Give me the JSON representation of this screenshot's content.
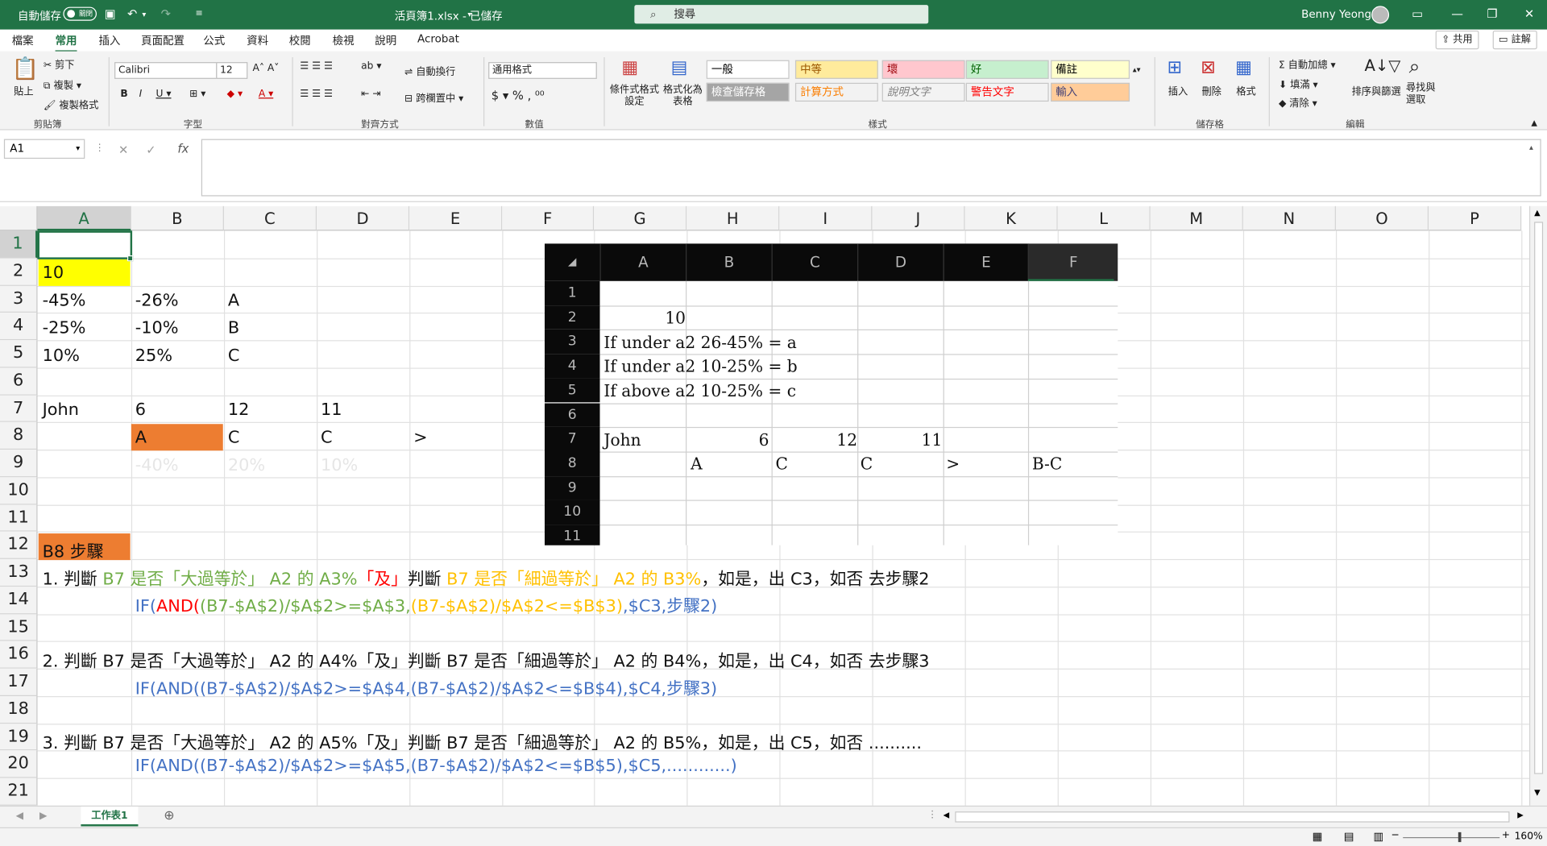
{
  "titlebar": {
    "autosave_label": "自動儲存",
    "autosave_state": "關閉",
    "doc_title": "活頁簿1.xlsx - 已儲存",
    "search_placeholder": "搜尋",
    "user_name": "Benny Yeong"
  },
  "tabs": [
    "檔案",
    "常用",
    "插入",
    "頁面配置",
    "公式",
    "資料",
    "校閱",
    "檢視",
    "說明",
    "Acrobat"
  ],
  "tab_buttons": {
    "share": "共用",
    "comments": "註解"
  },
  "ribbon": {
    "clipboard": {
      "paste": "貼上",
      "cut": "剪下",
      "copy": "複製",
      "format_painter": "複製格式",
      "label": "剪貼簿"
    },
    "font": {
      "name": "Calibri",
      "size": "12",
      "label": "字型"
    },
    "alignment": {
      "wrap": "自動換行",
      "merge": "跨欄置中",
      "label": "對齊方式"
    },
    "number": {
      "format": "通用格式",
      "label": "數值"
    },
    "styles": {
      "cond_format": "條件式格式設定",
      "format_table": "格式化為表格",
      "label": "樣式",
      "cells": [
        {
          "text": "一般",
          "bg": "#ffffff",
          "color": "#000000"
        },
        {
          "text": "中等",
          "bg": "#ffeb9c",
          "color": "#9c5700"
        },
        {
          "text": "壞",
          "bg": "#ffc7ce",
          "color": "#9c0006"
        },
        {
          "text": "好",
          "bg": "#c6efce",
          "color": "#006100"
        },
        {
          "text": "備註",
          "bg": "#ffffcc",
          "color": "#000000"
        },
        {
          "text": "檢查儲存格",
          "bg": "#a5a5a5",
          "color": "#ffffff"
        },
        {
          "text": "計算方式",
          "bg": "#f2f2f2",
          "color": "#fa7d00"
        },
        {
          "text": "說明文字",
          "bg": "#f3f3f3",
          "color": "#7f7f7f"
        },
        {
          "text": "警告文字",
          "bg": "#f3f3f3",
          "color": "#ff0000"
        },
        {
          "text": "輸入",
          "bg": "#ffcc99",
          "color": "#3f3f76"
        }
      ]
    },
    "cells_group": {
      "insert": "插入",
      "delete": "刪除",
      "format": "格式",
      "label": "儲存格"
    },
    "editing": {
      "autosum": "自動加總",
      "fill": "填滿",
      "clear": "清除",
      "sort": "排序與篩選",
      "find": "尋找與選取",
      "label": "編輯"
    }
  },
  "formula_bar": {
    "name_box": "A1",
    "fx": "fx",
    "content": ""
  },
  "columns": [
    "A",
    "B",
    "C",
    "D",
    "E",
    "F",
    "G",
    "H",
    "I",
    "J",
    "K",
    "L",
    "M",
    "N",
    "O",
    "P"
  ],
  "rows": [
    "1",
    "2",
    "3",
    "4",
    "5",
    "6",
    "7",
    "8",
    "9",
    "10",
    "11",
    "12",
    "13",
    "14",
    "15",
    "16",
    "17",
    "18",
    "19",
    "20",
    "21"
  ],
  "cells": {
    "A2": "10",
    "A3": "-45%",
    "B3": "-26%",
    "C3": "A",
    "A4": "-25%",
    "B4": "-10%",
    "C4": "B",
    "A5": "10%",
    "B5": "25%",
    "C5": "C",
    "A7": "John",
    "B7": "6",
    "C7": "12",
    "D7": "11",
    "B8": "A",
    "C8": "C",
    "D8": "C",
    "E8": ">",
    "B9": "-40%",
    "C9": "20%",
    "D9": "10%",
    "A12": "B8 步驟",
    "A16": "2. 判斷 B7 是否「大過等於」 A2 的 A4%「及」判斷 B7 是否「細過等於」 A2 的 B4%，如是，出 C4，如否 去步驟3",
    "B17": "IF(AND((B7-$A$2)/$A$2>=$A$4,(B7-$A$2)/$A$2<=$B$4),$C4,步驟3)",
    "A19": "3. 判斷 B7 是否「大過等於」 A2 的 A5%「及」判斷 B7 是否「細過等於」 A2 的 B5%，如是，出 C5，如否 ..........",
    "B20": "IF(AND((B7-$A$2)/$A$2>=$A$5,(B7-$A$2)/$A$2<=$B$5),$C5,............)"
  },
  "row13": [
    {
      "t": "1. 判斷 ",
      "c": "#111111"
    },
    {
      "t": "B7 是否「大過等於」 A2 的 A3%",
      "c": "#70ad47"
    },
    {
      "t": "「及」",
      "c": "#ff0000"
    },
    {
      "t": "判斷 ",
      "c": "#111111"
    },
    {
      "t": "B7 是否「細過等於」 A2 的 B3%",
      "c": "#ffc000"
    },
    {
      "t": "，如是，出 C3，如否 去步驟2",
      "c": "#111111"
    }
  ],
  "row14": [
    {
      "t": "IF(",
      "c": "#4472c4"
    },
    {
      "t": "AND(",
      "c": "#ff0000"
    },
    {
      "t": "(B7-$A$2)/$A$2>=$A$3,",
      "c": "#70ad47"
    },
    {
      "t": "(B7-$A$2)/$A$2<=$B$3)",
      "c": "#ffc000"
    },
    {
      "t": ",$C3,步驟2)",
      "c": "#4472c4"
    }
  ],
  "embed": {
    "columns": [
      "A",
      "B",
      "C",
      "D",
      "E",
      "F"
    ],
    "rows": [
      "1",
      "2",
      "3",
      "4",
      "5",
      "6",
      "7",
      "8",
      "9",
      "10",
      "11"
    ],
    "cells": {
      "A2": "10",
      "A3": "If under a2 26-45% = a",
      "A4": "If under a2 10-25% = b",
      "A5": "If above a2 10-25% = c",
      "A7": "John",
      "B7": "6",
      "C7": "12",
      "D7": "11",
      "B8": "A",
      "C8": "C",
      "D8": "C",
      "E8": ">",
      "F8": "B-C"
    }
  },
  "sheet": {
    "tab": "工作表1"
  },
  "status": {
    "zoom": "160%"
  },
  "colors": {
    "brand": "#217346",
    "highlight_yellow": "#ffff00",
    "highlight_orange": "#ed7d31"
  }
}
